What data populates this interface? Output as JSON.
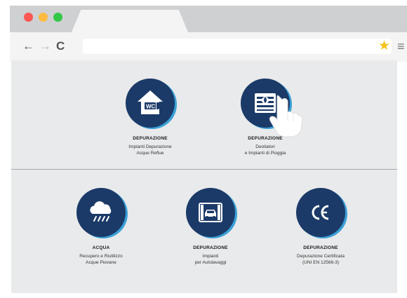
{
  "browser": {
    "icons": {
      "back": "←",
      "forward": "→",
      "reload": "C",
      "bookmark": "★",
      "menu": "≡"
    },
    "url": ""
  },
  "items": [
    {
      "icon": "wc-house-icon",
      "title": "DEPURAZIONE",
      "desc": "Impianti Depurazione\nAcque Reflue"
    },
    {
      "icon": "filter-tank-icon",
      "title": "DEPURAZIONE",
      "desc": "Deoliatori\ne Impianti di Pioggia"
    },
    {
      "icon": "rain-cloud-icon",
      "title": "ACQUA",
      "desc": "Recupero e Riutilizzo\nAcque Piovane"
    },
    {
      "icon": "car-wash-icon",
      "title": "DEPURAZIONE",
      "desc": "Impianti\nper Autolavaggi"
    },
    {
      "icon": "ce-mark-icon",
      "title": "DEPURAZIONE",
      "desc": "Depurazione Certificata\n(UNI EN 12566-3)"
    }
  ],
  "colors": {
    "circle": "#1b3a68",
    "circle_accent": "#3aa0d6",
    "content_bg": "#e9eaeb"
  }
}
